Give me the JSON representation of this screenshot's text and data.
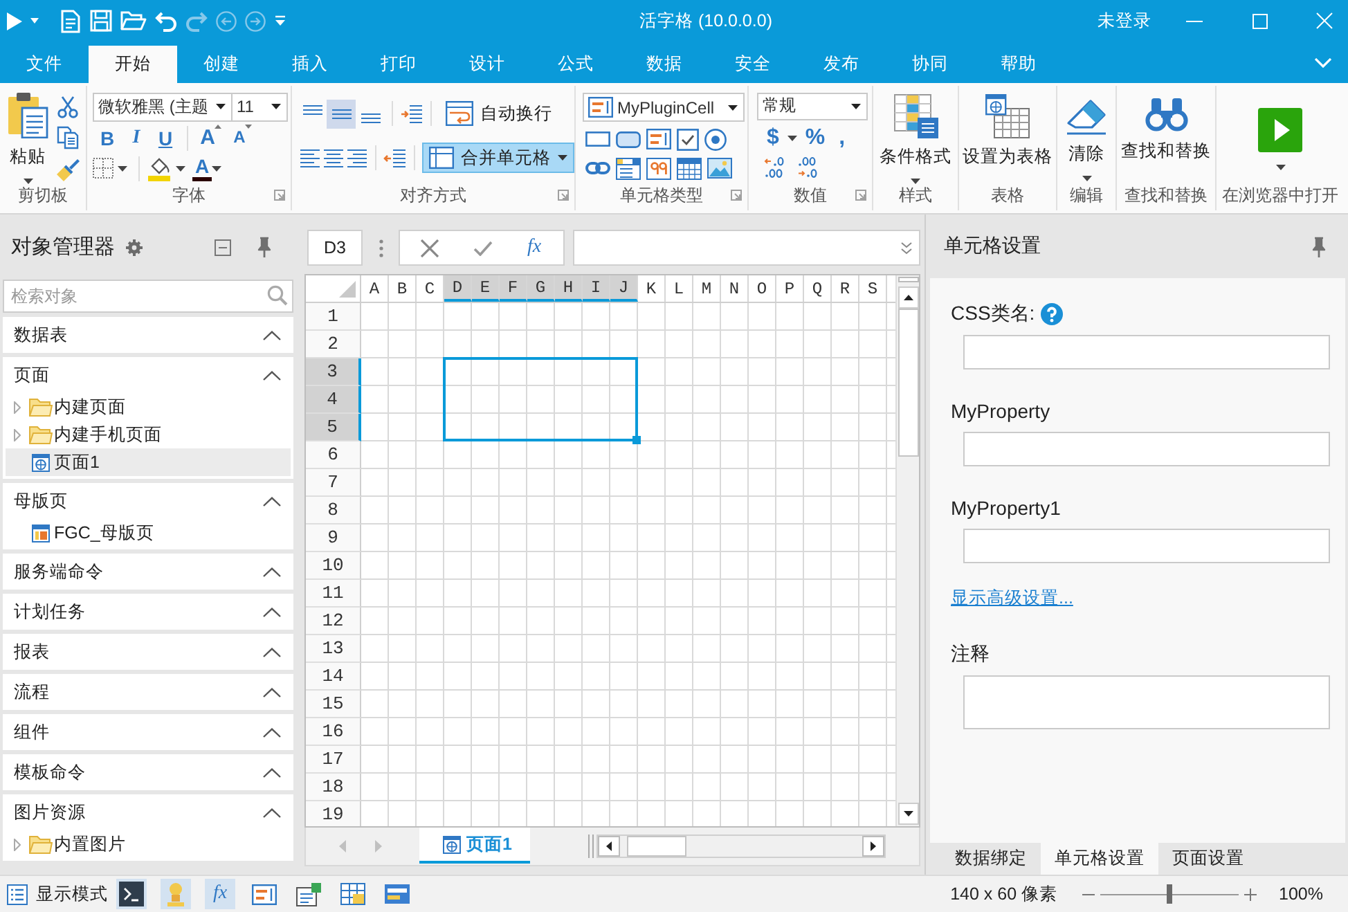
{
  "title_bar": {
    "title": "活字格 (10.0.0.0)",
    "user": "未登录"
  },
  "tabs": [
    {
      "label": "文件",
      "selected": false
    },
    {
      "label": "开始",
      "selected": true
    },
    {
      "label": "创建",
      "selected": false
    },
    {
      "label": "插入",
      "selected": false
    },
    {
      "label": "打印",
      "selected": false
    },
    {
      "label": "设计",
      "selected": false
    },
    {
      "label": "公式",
      "selected": false
    },
    {
      "label": "数据",
      "selected": false
    },
    {
      "label": "安全",
      "selected": false
    },
    {
      "label": "发布",
      "selected": false
    },
    {
      "label": "协同",
      "selected": false
    },
    {
      "label": "帮助",
      "selected": false
    }
  ],
  "ribbon": [
    {
      "kind": "clipboard",
      "label": "剪切板",
      "paste": "粘贴"
    },
    {
      "kind": "font",
      "label": "字体",
      "font": "微软雅黑 (主题",
      "size": "11",
      "styles": [
        {
          "kind": "bold",
          "label": "B"
        },
        {
          "kind": "italic",
          "label": "I"
        },
        {
          "kind": "underline",
          "label": "U"
        }
      ],
      "sizers": [
        {
          "kind": "grow",
          "label": "A"
        },
        {
          "kind": "shrink",
          "label": "A"
        }
      ],
      "font_color": "A"
    },
    {
      "kind": "align",
      "label": "对齐方式",
      "align": [
        {
          "kind": "top",
          "selected": false
        },
        {
          "kind": "middle",
          "selected": true
        },
        {
          "kind": "bottom",
          "selected": false
        },
        {
          "kind": "left",
          "selected": false
        },
        {
          "kind": "center",
          "selected": false
        },
        {
          "kind": "right",
          "selected": false
        }
      ],
      "wrap": {
        "label": "自动换行",
        "on": false
      },
      "merge": {
        "label": "合并单元格",
        "on": true
      }
    },
    {
      "kind": "celltype",
      "label": "单元格类型",
      "current": "MyPluginCell"
    },
    {
      "kind": "number",
      "label": "数值",
      "format": "常规",
      "symbols": [
        {
          "kind": "currency",
          "label": "$"
        },
        {
          "kind": "percent",
          "label": "%"
        },
        {
          "kind": "comma",
          "label": ","
        }
      ]
    },
    {
      "kind": "style",
      "label": "样式",
      "button": "条件格式"
    },
    {
      "kind": "table",
      "label": "表格",
      "button": "设置为表格"
    },
    {
      "kind": "edit",
      "label": "编辑",
      "button": "清除"
    },
    {
      "kind": "find",
      "label": "查找和替换",
      "button": "查找和替换"
    },
    {
      "kind": "browser",
      "label": "在浏览器中打开"
    }
  ],
  "object_manager": {
    "title": "对象管理器",
    "search": {
      "placeholder": "检索对象"
    },
    "sections": [
      {
        "title": "数据表"
      },
      {
        "title": "页面",
        "items": [
          {
            "kind": "folder",
            "label": "内建页面",
            "expanded": false,
            "selected": false
          },
          {
            "kind": "folder",
            "label": "内建手机页面",
            "expanded": false,
            "selected": false
          },
          {
            "kind": "page",
            "label": "页面1",
            "selected": true
          }
        ]
      },
      {
        "title": "母版页",
        "items": [
          {
            "kind": "master",
            "label": "FGC_母版页",
            "selected": false
          }
        ]
      },
      {
        "title": "服务端命令"
      },
      {
        "title": "计划任务"
      },
      {
        "title": "报表"
      },
      {
        "title": "流程"
      },
      {
        "title": "组件"
      },
      {
        "title": "模板命令"
      },
      {
        "title": "图片资源",
        "items": [
          {
            "kind": "folder",
            "label": "内置图片",
            "expanded": false,
            "selected": false
          }
        ]
      }
    ]
  },
  "formula_bar": {
    "cell": "D3",
    "function": "fx"
  },
  "grid": {
    "columns": [
      {
        "label": "A",
        "selected": false
      },
      {
        "label": "B",
        "selected": false
      },
      {
        "label": "C",
        "selected": false
      },
      {
        "label": "D",
        "selected": true
      },
      {
        "label": "E",
        "selected": true
      },
      {
        "label": "F",
        "selected": true
      },
      {
        "label": "G",
        "selected": true
      },
      {
        "label": "H",
        "selected": true
      },
      {
        "label": "I",
        "selected": true
      },
      {
        "label": "J",
        "selected": true
      },
      {
        "label": "K",
        "selected": false
      },
      {
        "label": "L",
        "selected": false
      },
      {
        "label": "M",
        "selected": false
      },
      {
        "label": "N",
        "selected": false
      },
      {
        "label": "O",
        "selected": false
      },
      {
        "label": "P",
        "selected": false
      },
      {
        "label": "Q",
        "selected": false
      },
      {
        "label": "R",
        "selected": false
      },
      {
        "label": "S",
        "selected": false
      }
    ],
    "rows": [
      {
        "label": "1",
        "selected": false
      },
      {
        "label": "2",
        "selected": false
      },
      {
        "label": "3",
        "selected": true
      },
      {
        "label": "4",
        "selected": true
      },
      {
        "label": "5",
        "selected": true
      },
      {
        "label": "6",
        "selected": false
      },
      {
        "label": "7",
        "selected": false
      },
      {
        "label": "8",
        "selected": false
      },
      {
        "label": "9",
        "selected": false
      },
      {
        "label": "10",
        "selected": false
      },
      {
        "label": "11",
        "selected": false
      },
      {
        "label": "12",
        "selected": false
      },
      {
        "label": "13",
        "selected": false
      },
      {
        "label": "14",
        "selected": false
      },
      {
        "label": "15",
        "selected": false
      },
      {
        "label": "16",
        "selected": false
      },
      {
        "label": "17",
        "selected": false
      },
      {
        "label": "18",
        "selected": false
      },
      {
        "label": "19",
        "selected": false
      }
    ]
  },
  "sheet_tabs": [
    {
      "label": "页面1",
      "selected": true
    }
  ],
  "cell_settings": {
    "title": "单元格设置",
    "fields": [
      {
        "label": "CSS类名:",
        "help": true
      },
      {
        "label": "MyProperty",
        "help": false
      },
      {
        "label": "MyProperty1",
        "help": false
      }
    ],
    "advanced_link": "显示高级设置...",
    "notes_label": "注释",
    "tabs": [
      {
        "label": "数据绑定",
        "selected": false
      },
      {
        "label": "单元格设置",
        "selected": true
      },
      {
        "label": "页面设置",
        "selected": false
      }
    ]
  },
  "status_bar": {
    "mode": "显示模式",
    "tools": [
      {
        "kind": "console",
        "on": true
      },
      {
        "kind": "lamp",
        "on": true
      },
      {
        "kind": "formula",
        "label": "fx",
        "on": true
      },
      {
        "kind": "textbox",
        "on": false
      },
      {
        "kind": "form",
        "on": false
      },
      {
        "kind": "grid",
        "on": false
      },
      {
        "kind": "panel",
        "on": false
      }
    ],
    "size": "140 x 60 像素",
    "zoom": {
      "level": 0.5,
      "reading": "100%"
    }
  }
}
